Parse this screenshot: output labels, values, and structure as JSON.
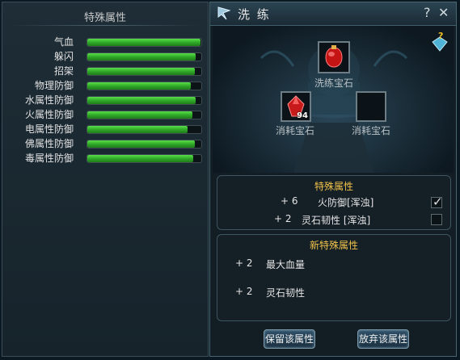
{
  "left_panel": {
    "title": "特殊属性",
    "stats": [
      {
        "label": "气血",
        "fill": 0.99
      },
      {
        "label": "躲闪",
        "fill": 0.95
      },
      {
        "label": "招架",
        "fill": 0.94
      },
      {
        "label": "物理防御",
        "fill": 0.91
      },
      {
        "label": "水属性防御",
        "fill": 0.95
      },
      {
        "label": "火属性防御",
        "fill": 0.92
      },
      {
        "label": "电属性防御",
        "fill": 0.88
      },
      {
        "label": "佛属性防御",
        "fill": 0.94
      },
      {
        "label": "毒属性防御",
        "fill": 0.93
      }
    ]
  },
  "dialog": {
    "title": "洗 练",
    "help_label": "?",
    "close_label": "✕",
    "main_slot_label": "洗练宝石",
    "consume_slot_1": {
      "label": "消耗宝石",
      "count": "94"
    },
    "consume_slot_2": {
      "label": "消耗宝石"
    },
    "special_box": {
      "title": "特殊属性",
      "rows": [
        {
          "value": "+ 6",
          "text": "火防御[浑浊]",
          "checked": true
        },
        {
          "value": "+ 2",
          "text": "灵石韧性 [浑浊]",
          "checked": false
        }
      ]
    },
    "new_box": {
      "title": "新特殊属性",
      "rows": [
        {
          "value": "+ 2",
          "text": "最大血量"
        },
        {
          "value": "+ 2",
          "text": "灵石韧性"
        }
      ]
    },
    "keep_button": "保留该属性",
    "discard_button": "放弃该属性"
  },
  "colors": {
    "bar_green": "#2fa828",
    "box_title": "#f0c24a",
    "gem_red": "#d01818"
  }
}
